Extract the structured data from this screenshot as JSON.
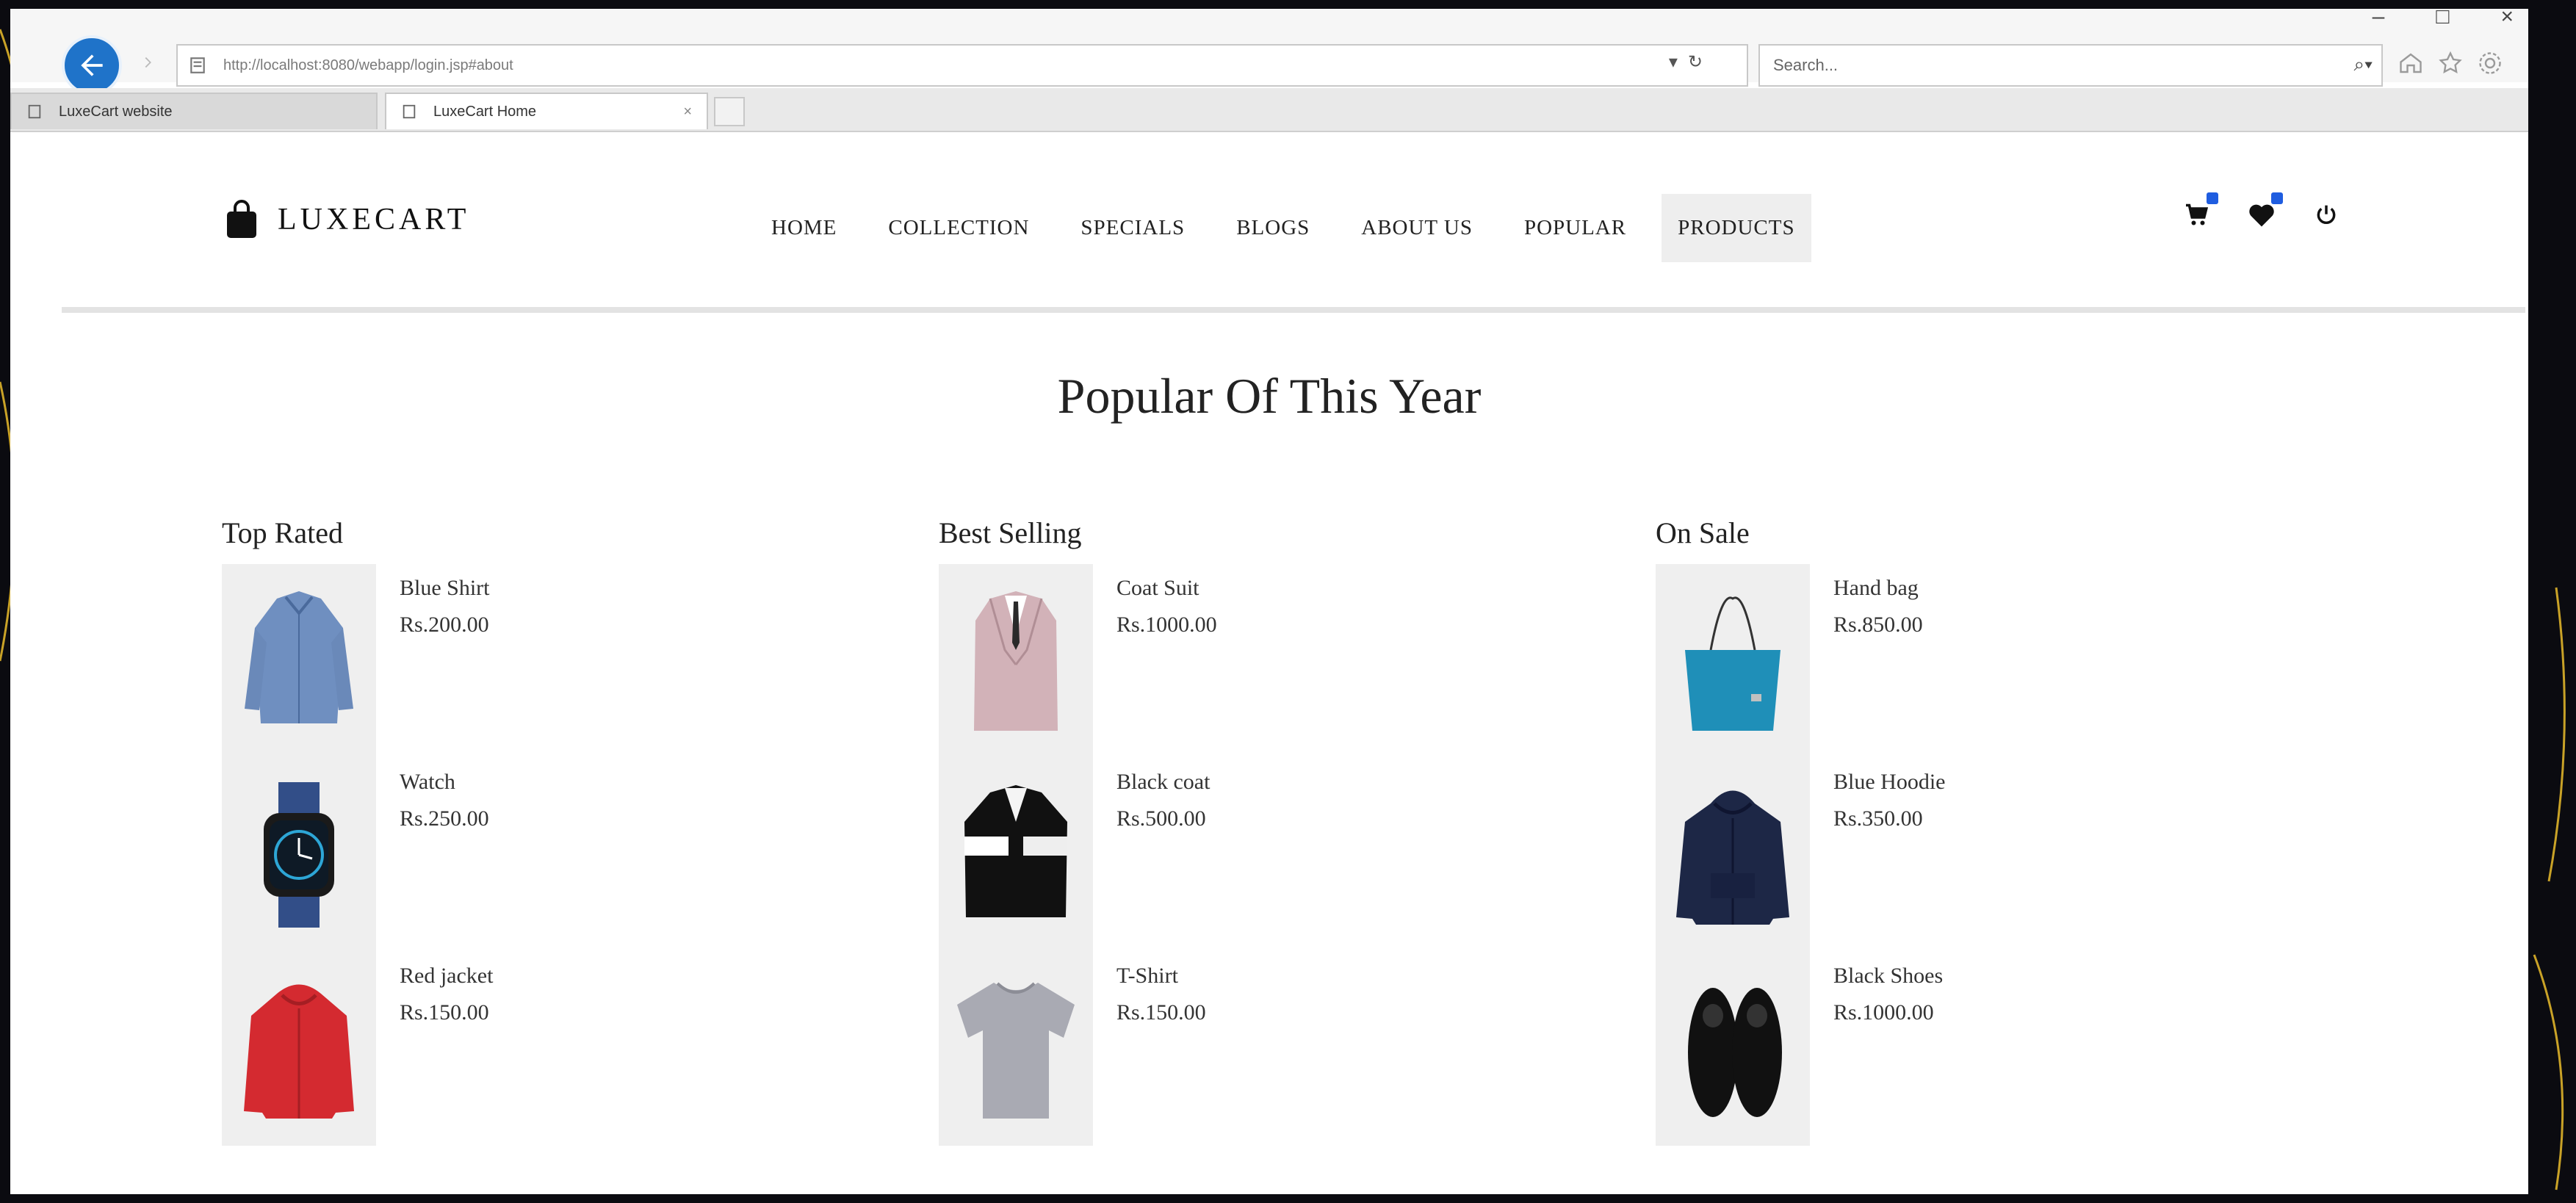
{
  "browser": {
    "address_url": "http://localhost:8080/webapp/login.jsp#about",
    "search_placeholder": "Search...",
    "tabs": [
      {
        "label": "LuxeCart website"
      },
      {
        "label": "LuxeCart Home"
      }
    ]
  },
  "header": {
    "brand": "LUXECART",
    "nav": [
      "HOME",
      "COLLECTION",
      "SPECIALS",
      "BLOGS",
      "ABOUT US",
      "POPULAR",
      "PRODUCTS"
    ],
    "active_nav": "PRODUCTS",
    "icons": [
      "cart-icon",
      "heart-icon",
      "power-icon"
    ],
    "badge_color": "#1f5de0"
  },
  "main": {
    "title": "Popular Of This Year",
    "columns": [
      {
        "title": "Top Rated",
        "products": [
          {
            "name": "Blue Shirt",
            "price": "Rs.200.00",
            "image": "blue-shirt-image"
          },
          {
            "name": "Watch",
            "price": "Rs.250.00",
            "image": "watch-image"
          },
          {
            "name": "Red jacket",
            "price": "Rs.150.00",
            "image": "red-jacket-image"
          }
        ]
      },
      {
        "title": "Best Selling",
        "products": [
          {
            "name": "Coat Suit",
            "price": "Rs.1000.00",
            "image": "coat-suit-image"
          },
          {
            "name": "Black coat",
            "price": "Rs.500.00",
            "image": "black-coat-image"
          },
          {
            "name": "T-Shirt",
            "price": "Rs.150.00",
            "image": "t-shirt-image"
          }
        ]
      },
      {
        "title": "On Sale",
        "products": [
          {
            "name": "Hand bag",
            "price": "Rs.850.00",
            "image": "hand-bag-image"
          },
          {
            "name": "Blue Hoodie",
            "price": "Rs.350.00",
            "image": "blue-hoodie-image"
          },
          {
            "name": "Black Shoes",
            "price": "Rs.1000.00",
            "image": "black-shoes-image"
          }
        ]
      }
    ]
  }
}
